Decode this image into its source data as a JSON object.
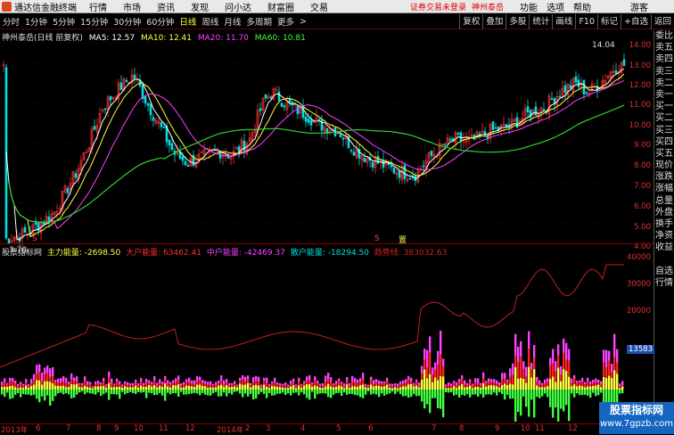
{
  "menubar": {
    "app_title": "通达信金融终端",
    "menus": [
      "行情",
      "市场",
      "资讯",
      "发现",
      "问小达",
      "财富圈",
      "交易"
    ],
    "notice": "证券交易未登录",
    "stock_name": "神州泰岳",
    "right_menus": [
      "功能",
      "选项",
      "帮助"
    ],
    "guest": "游客"
  },
  "toolbar": {
    "periods": [
      "分时",
      "1分钟",
      "5分钟",
      "15分钟",
      "30分钟",
      "60分钟",
      "日线",
      "周线",
      "月线",
      "多周期",
      "更多"
    ],
    "active": "日线",
    "more_arrow": ">",
    "right_buttons": [
      "复权",
      "叠加",
      "多股",
      "统计",
      "画线",
      "F10",
      "标记",
      "+自选",
      "返回"
    ]
  },
  "stock_info": {
    "name": "神州泰岳(日线 前复权)",
    "ma5": "MA5: 12.57",
    "ma10": "MA10: 12.41",
    "ma20": "MA20: 11.70",
    "ma60": "MA60: 10.81"
  },
  "side_panel": [
    "委比",
    "卖五",
    "卖四",
    "卖三",
    "卖二",
    "卖一",
    "买一",
    "买二",
    "买三",
    "买四",
    "买五",
    "现价",
    "涨跌",
    "涨幅",
    "总量",
    "外盘",
    "换手",
    "净资",
    "收益",
    "",
    "自选",
    "行情"
  ],
  "price_axis": [
    "14.00",
    "13.00",
    "12.00",
    "11.00",
    "10.00",
    "9.00",
    "8.00",
    "7.00",
    "6.00",
    "5.00",
    "4.00"
  ],
  "price_labels": {
    "high": "14.04",
    "low": "3.78"
  },
  "markers": {
    "s1": "S",
    "s2": "S",
    "box": "置"
  },
  "indicator_info": {
    "name": "股票指标网",
    "main": "主力能量: -2698.50",
    "big": "大户能量: 63462.41",
    "mid": "中户能量: -42469.37",
    "retail": "散户能量: -18294.50",
    "trend": "趋势线: 383032.63"
  },
  "indicator_axis": [
    "40000",
    "30000",
    "20000",
    "10000"
  ],
  "indicator_badge": "13583",
  "xaxis": [
    "2013年",
    "6",
    "7",
    "8",
    "9",
    "10",
    "11",
    "12",
    "2014年",
    "2",
    "3",
    "4",
    "5",
    "6",
    "7",
    "8",
    "9",
    "10",
    "11",
    "12"
  ],
  "watermark": {
    "line1": "股票指标网",
    "line2": "www.7gpzb.com"
  },
  "colors": {
    "up": "#ff3030",
    "down": "#00e0e0",
    "ma5": "#ffffff",
    "ma10": "#ffff40",
    "ma20": "#ff40ff",
    "ma60": "#40ff40"
  }
}
